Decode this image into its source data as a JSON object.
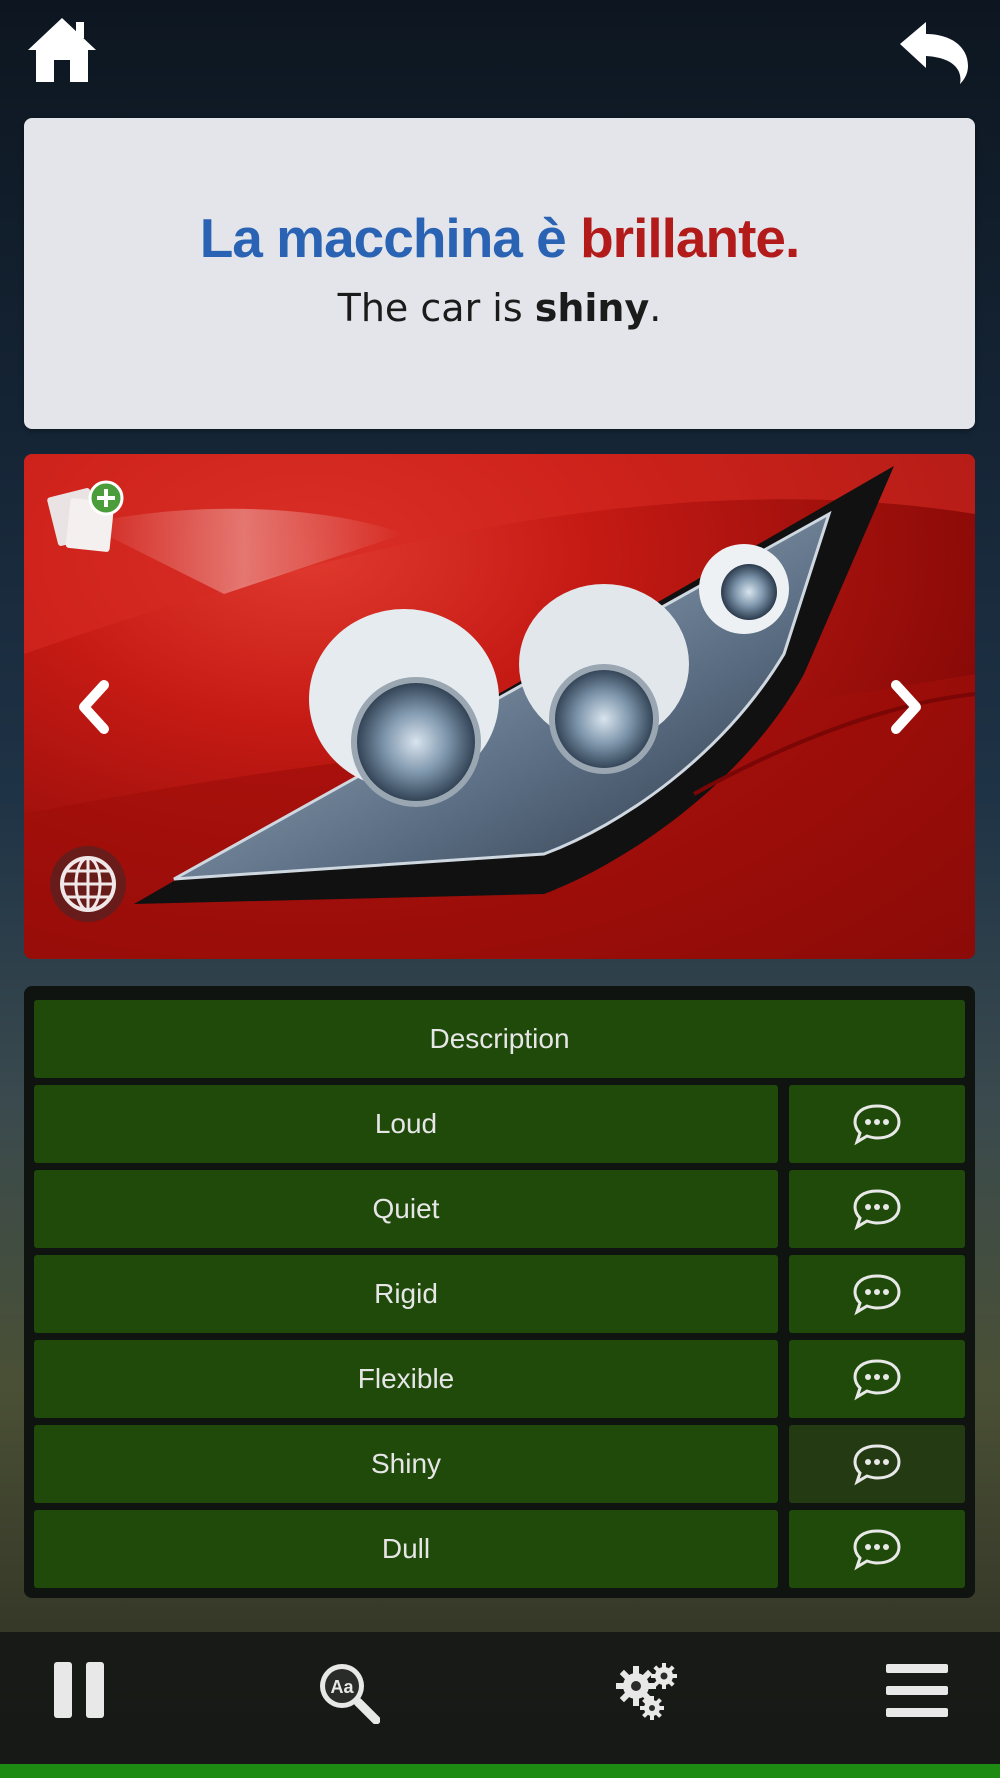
{
  "toolbar": {
    "home_icon": "home-icon",
    "back_icon": "undo-arrow-icon"
  },
  "sentence": {
    "italian_main": "La macchina è ",
    "italian_highlight": "brillante.",
    "english_main": "The car is ",
    "english_highlight": "shiny",
    "english_end": ".",
    "colors": {
      "italian": "#2a63b4",
      "highlight": "#b31b1b"
    }
  },
  "image": {
    "add_card_icon": "add-flashcard-icon",
    "prev_icon": "chevron-left-icon",
    "next_icon": "chevron-right-icon",
    "globe_icon": "globe-icon"
  },
  "list": {
    "header": "Description",
    "items": [
      {
        "label": "Loud"
      },
      {
        "label": "Quiet"
      },
      {
        "label": "Rigid"
      },
      {
        "label": "Flexible"
      },
      {
        "label": "Shiny"
      },
      {
        "label": "Dull"
      }
    ],
    "speak_icon": "speech-bubble-icon",
    "accent": "#1f4a0a"
  },
  "bottom_nav": {
    "items": [
      "pause-icon",
      "dictionary-search-icon",
      "settings-gears-icon",
      "menu-icon"
    ],
    "dictionary_glyph": "Aa"
  }
}
